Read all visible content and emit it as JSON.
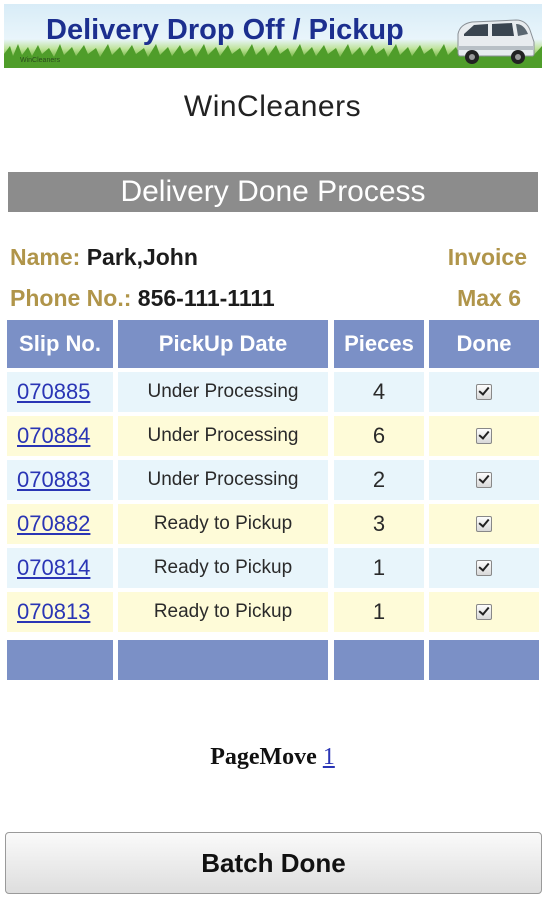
{
  "header": {
    "banner_title": "Delivery Drop Off / Pickup",
    "logo_text": "WinCleaners",
    "company_name": "WinCleaners"
  },
  "section_title": "Delivery Done Process",
  "customer": {
    "name_label": "Name:",
    "name_value": "Park,John",
    "phone_label": "Phone No.:",
    "phone_value": "856-111-1111",
    "invoice_label": "Invoice",
    "max_label": "Max 6"
  },
  "table": {
    "headers": [
      "Slip No.",
      "PickUp Date",
      "Pieces",
      "Done"
    ],
    "rows": [
      {
        "slip": "070885",
        "status": "Under Processing",
        "pieces": "4",
        "done": true
      },
      {
        "slip": "070884",
        "status": "Under Processing",
        "pieces": "6",
        "done": true
      },
      {
        "slip": "070883",
        "status": "Under Processing",
        "pieces": "2",
        "done": true
      },
      {
        "slip": "070882",
        "status": "Ready to Pickup",
        "pieces": "3",
        "done": true
      },
      {
        "slip": "070814",
        "status": "Ready to Pickup",
        "pieces": "1",
        "done": true
      },
      {
        "slip": "070813",
        "status": "Ready to Pickup",
        "pieces": "1",
        "done": true
      }
    ]
  },
  "pagination": {
    "label": "PageMove",
    "page": "1"
  },
  "actions": {
    "batch_done_label": "Batch Done"
  },
  "colors": {
    "header_blue": "#7b90c6",
    "label_gold": "#b0954a",
    "row_blue": "#e8f5fb",
    "row_yellow": "#fefbd8",
    "title_gray": "#8c8c8c"
  }
}
